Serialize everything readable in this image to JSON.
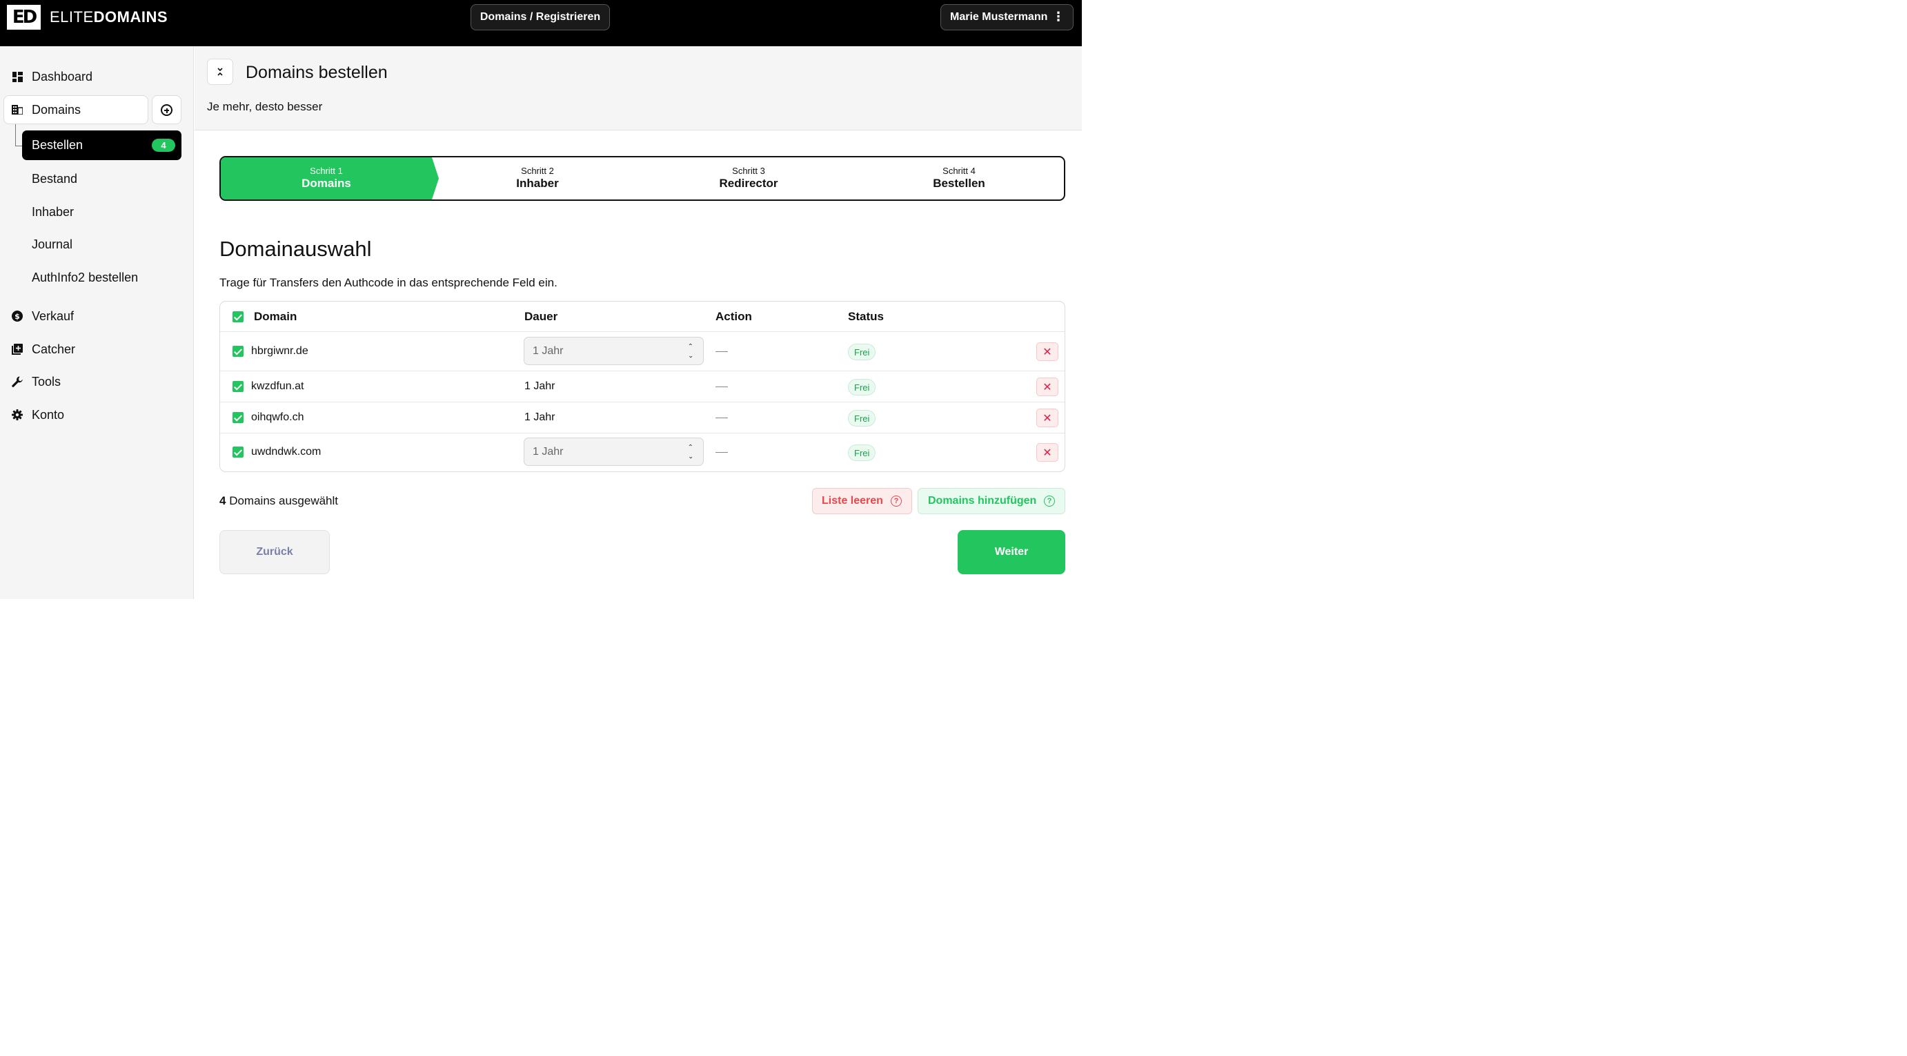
{
  "header": {
    "logo_mark": "ED",
    "logo_text_light": "ELITE",
    "logo_text_bold": "DOMAINS",
    "center_button": "Domains / Registrieren",
    "user_name": "Marie Mustermann",
    "user_menu_icon": "⋮"
  },
  "sidebar": {
    "dashboard": "Dashboard",
    "domains": "Domains",
    "sub": {
      "bestellen": "Bestellen",
      "bestellen_badge": "4",
      "bestand": "Bestand",
      "inhaber": "Inhaber",
      "journal": "Journal",
      "authinfo": "AuthInfo2 bestellen"
    },
    "verkauf": "Verkauf",
    "catcher": "Catcher",
    "tools": "Tools",
    "konto": "Konto"
  },
  "page": {
    "title": "Domains bestellen",
    "subtitle": "Je mehr, desto besser"
  },
  "steps": [
    {
      "num": "Schritt 1",
      "name": "Domains",
      "active": true
    },
    {
      "num": "Schritt 2",
      "name": "Inhaber",
      "active": false
    },
    {
      "num": "Schritt 3",
      "name": "Redirector",
      "active": false
    },
    {
      "num": "Schritt 4",
      "name": "Bestellen",
      "active": false
    }
  ],
  "section": {
    "title": "Domainauswahl",
    "description": "Trage für Transfers den Authcode in das entsprechende Feld ein."
  },
  "table": {
    "headers": {
      "domain": "Domain",
      "dauer": "Dauer",
      "action": "Action",
      "status": "Status"
    },
    "rows": [
      {
        "domain": "hbrgiwnr.de",
        "dauer": "1 Jahr",
        "dauer_select": true,
        "status": "Frei"
      },
      {
        "domain": "kwzdfun.at",
        "dauer": "1 Jahr",
        "dauer_select": false,
        "status": "Frei"
      },
      {
        "domain": "oihqwfo.ch",
        "dauer": "1 Jahr",
        "dauer_select": false,
        "status": "Frei"
      },
      {
        "domain": "uwdndwk.com",
        "dauer": "1 Jahr",
        "dauer_select": true,
        "status": "Frei"
      }
    ]
  },
  "footer": {
    "count": "4",
    "count_label": "Domains ausgewählt",
    "clear_label": "Liste leeren",
    "add_label": "Domains hinzufügen",
    "back_label": "Zurück",
    "next_label": "Weiter"
  },
  "colors": {
    "accent": "#22c55e",
    "danger": "#e5484d",
    "topbar": "#000000"
  }
}
